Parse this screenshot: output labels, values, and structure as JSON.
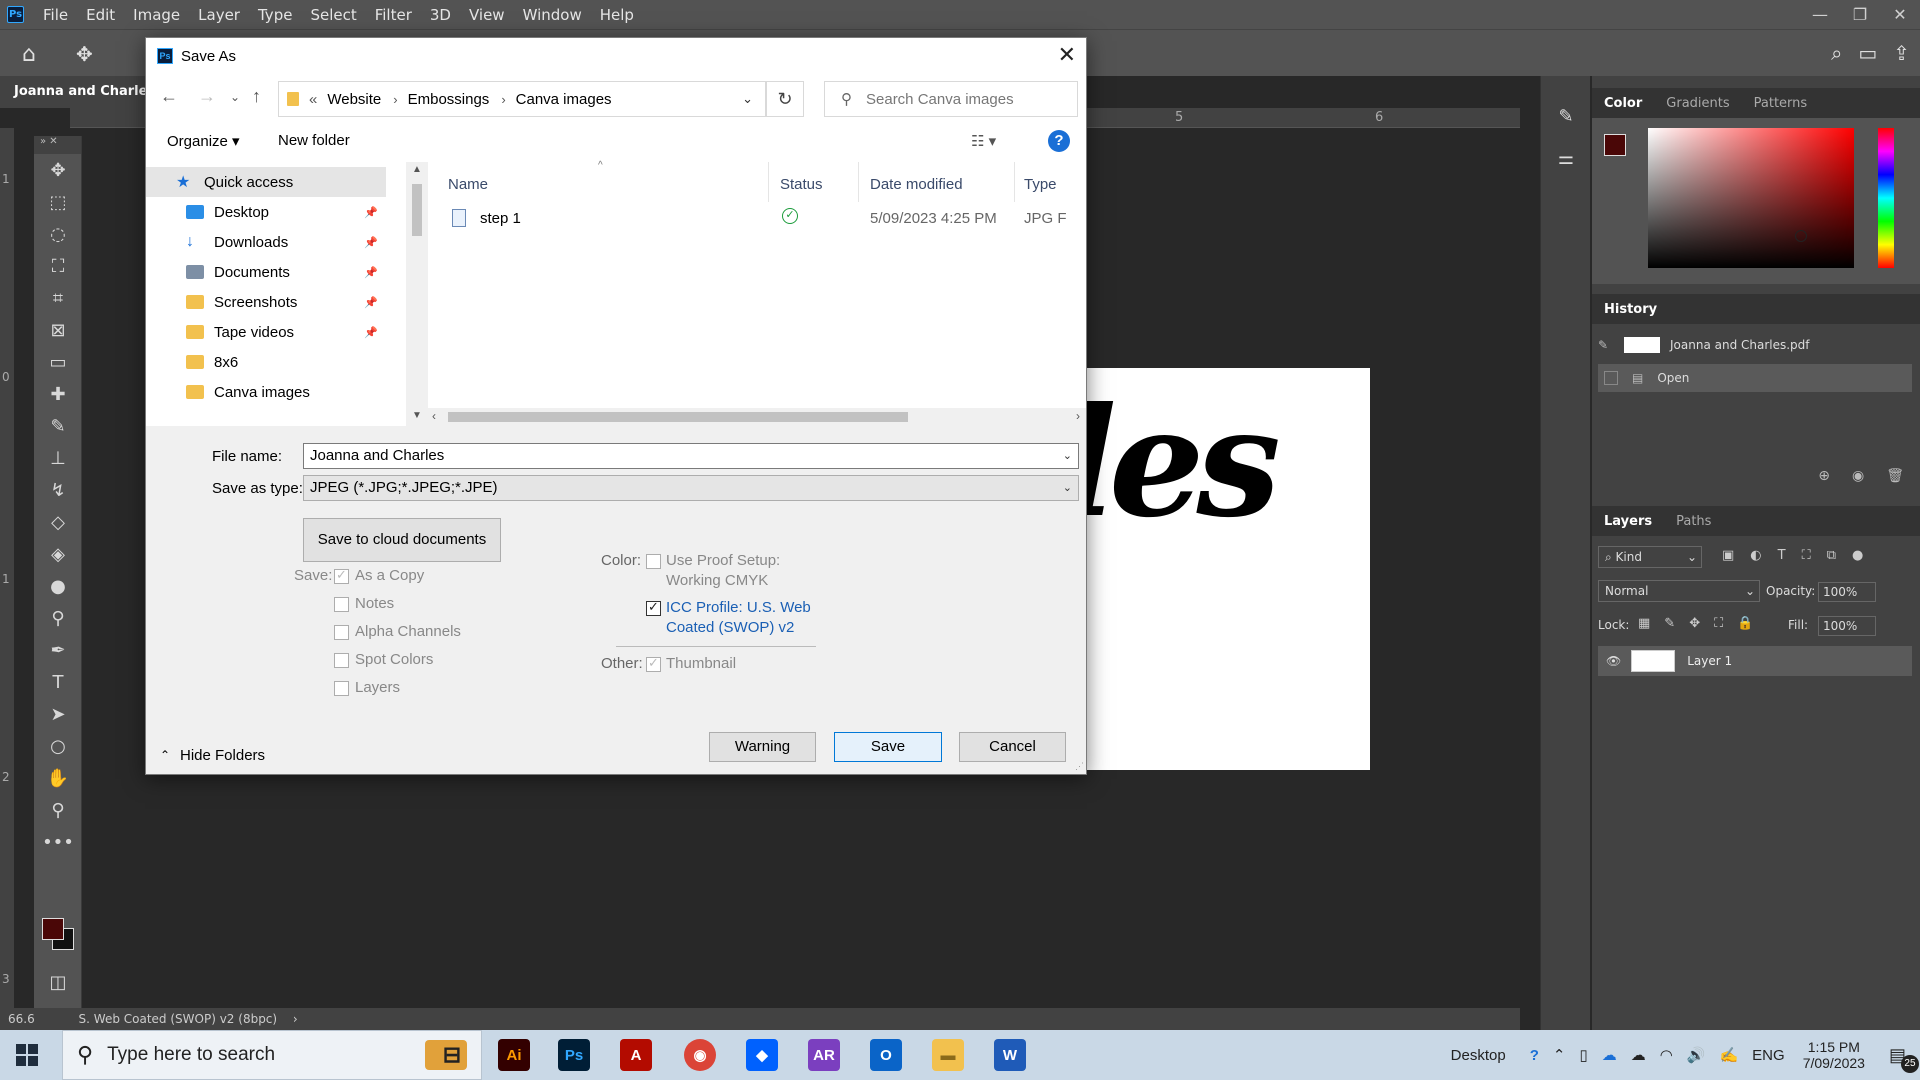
{
  "app": {
    "logo": "Ps",
    "menu": [
      "File",
      "Edit",
      "Image",
      "Layer",
      "Type",
      "Select",
      "Filter",
      "3D",
      "View",
      "Window",
      "Help"
    ],
    "doc_tab": "Joanna and Charles.p",
    "ruler_marks": [
      "5",
      "6"
    ],
    "ruler_left_marks": [
      "1",
      "0",
      "1",
      "2",
      "3"
    ],
    "zoom": "66.6",
    "status_text": "S. Web Coated (SWOP) v2 (8bpc)",
    "canvas_text": "les",
    "accent": "#31a8ff",
    "foreground_color": "#4a0707"
  },
  "dialog": {
    "title": "Save As",
    "breadcrumb": [
      "«",
      "Website",
      "Embossings",
      "Canva images"
    ],
    "search_placeholder": "Search Canva images",
    "organize": "Organize ▾",
    "new_folder": "New folder",
    "help": "?",
    "nav_items": [
      {
        "label": "Quick access",
        "icon": "star-icon",
        "color": "#1a6fd6"
      },
      {
        "label": "Desktop",
        "icon": "desktop-folder-icon",
        "color": "#2b8ee6",
        "pinned": true
      },
      {
        "label": "Downloads",
        "icon": "downloads-icon",
        "color": "#1a6fd6",
        "pinned": true
      },
      {
        "label": "Documents",
        "icon": "documents-icon",
        "color": "#7d8fa5",
        "pinned": true
      },
      {
        "label": "Screenshots",
        "icon": "folder-icon",
        "color": "#f2c14e",
        "pinned": true
      },
      {
        "label": "Tape videos",
        "icon": "folder-icon",
        "color": "#f2c14e",
        "pinned": true
      },
      {
        "label": "8x6",
        "icon": "folder-icon",
        "color": "#f2c14e"
      },
      {
        "label": "Canva images",
        "icon": "folder-icon",
        "color": "#f2c14e"
      }
    ],
    "columns": [
      "Name",
      "Status",
      "Date modified",
      "Type"
    ],
    "files": [
      {
        "name": "step 1",
        "status": "synced",
        "date": "5/09/2023 4:25 PM",
        "type": "JPG F"
      }
    ],
    "file_name_label": "File name:",
    "file_name": "Joanna and Charles",
    "save_type_label": "Save as type:",
    "save_type": "JPEG (*.JPG;*.JPEG;*.JPE)",
    "save_cloud": "Save to cloud documents",
    "save_label": "Save:",
    "save_options": [
      {
        "label": "As a Copy",
        "checked": true,
        "disabled": true
      },
      {
        "label": "Notes",
        "checked": false,
        "disabled": true
      },
      {
        "label": "Alpha Channels",
        "checked": false,
        "disabled": true
      },
      {
        "label": "Spot Colors",
        "checked": false,
        "disabled": true
      },
      {
        "label": "Layers",
        "checked": false,
        "disabled": true
      }
    ],
    "color_label": "Color:",
    "proof_setup": "Use Proof Setup:",
    "proof_setup_2": "Working CMYK",
    "icc_profile": "ICC Profile:  U.S. Web",
    "icc_profile_2": "Coated (SWOP) v2",
    "other_label": "Other:",
    "thumbnail": "Thumbnail",
    "hide_folders": "Hide Folders",
    "warning_btn": "Warning",
    "save_btn": "Save",
    "cancel_btn": "Cancel"
  },
  "panels": {
    "color_tabs": [
      "Color",
      "Gradients",
      "Patterns"
    ],
    "history_title": "History",
    "history_items": [
      "Joanna and Charles.pdf",
      "Open"
    ],
    "layers_tabs": [
      "Layers",
      "Paths"
    ],
    "kind": "Kind",
    "blend_mode": "Normal",
    "opacity_label": "Opacity:",
    "opacity": "100%",
    "lock_label": "Lock:",
    "fill_label": "Fill:",
    "fill": "100%",
    "layer_name": "Layer 1"
  },
  "taskbar": {
    "search_text": "Type here to search",
    "desktop_label": "Desktop",
    "language": "ENG",
    "time": "1:15 PM",
    "date": "7/09/2023",
    "notif_count": "25"
  }
}
